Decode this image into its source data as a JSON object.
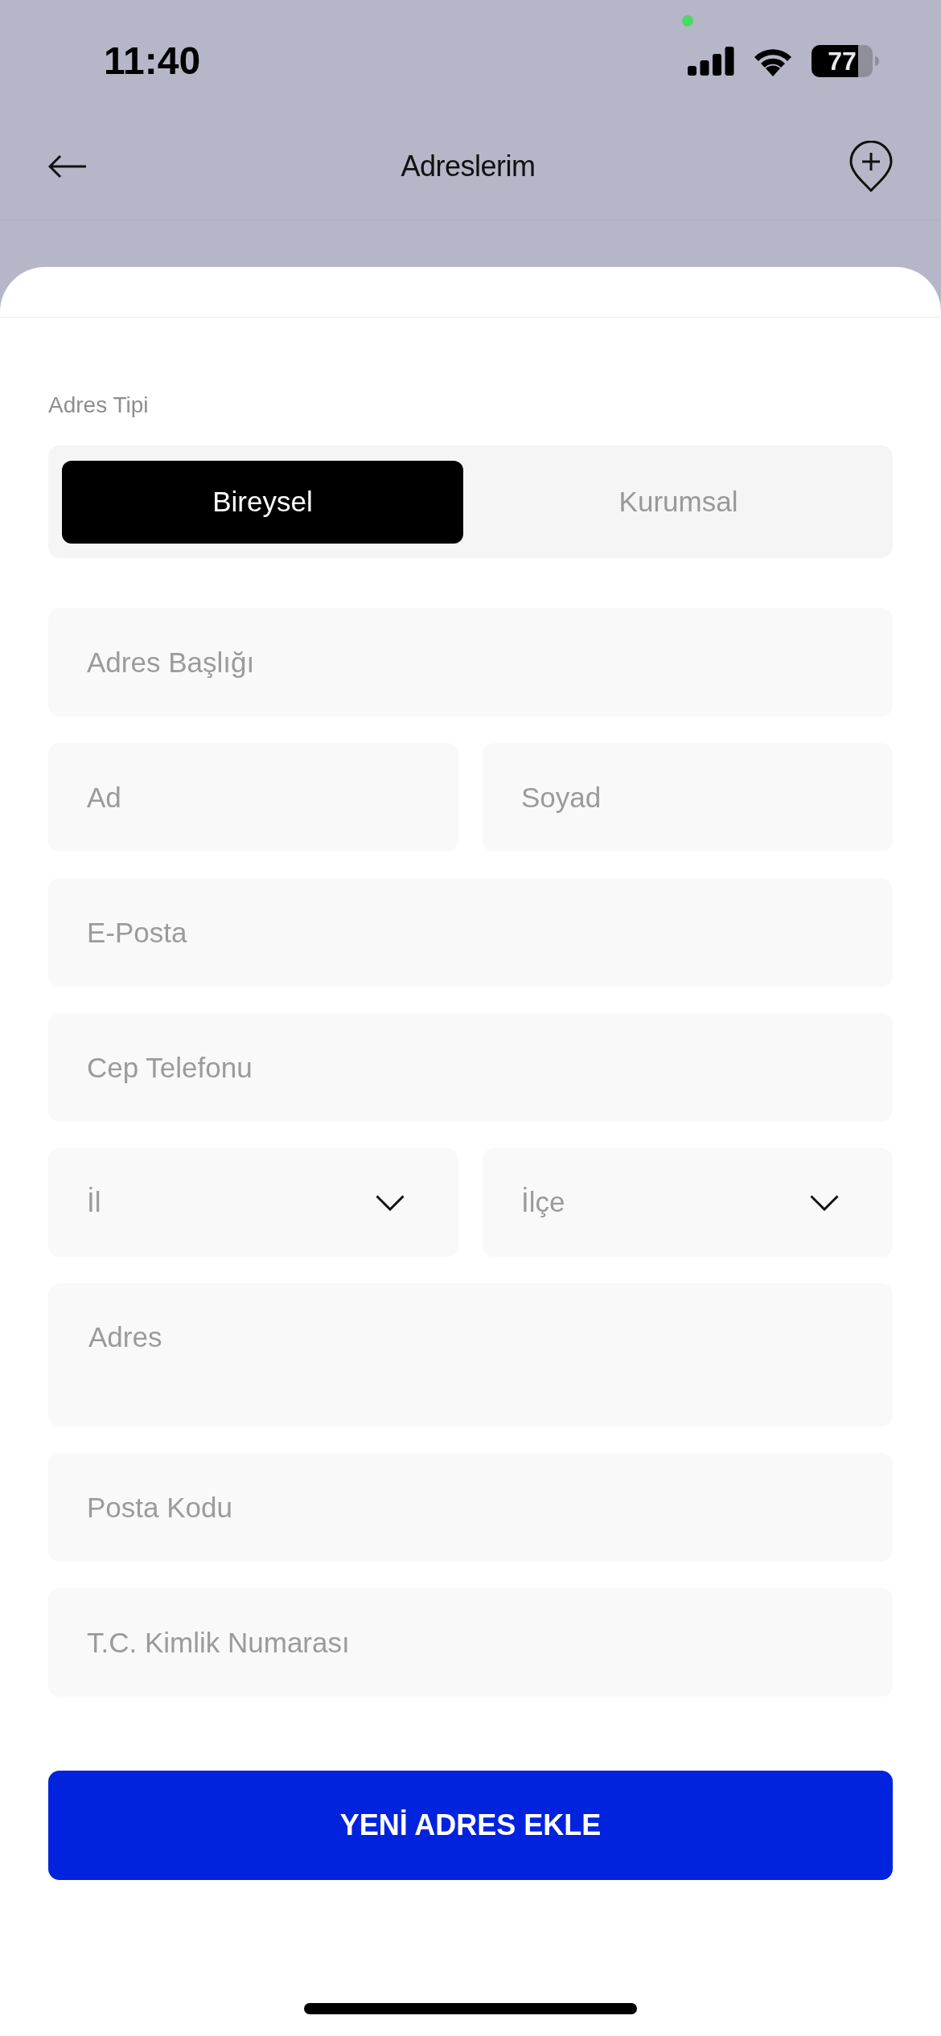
{
  "status_bar": {
    "time": "11:40",
    "battery": "77"
  },
  "header": {
    "title": "Adreslerim"
  },
  "form": {
    "address_type_label": "Adres Tipi",
    "address_type_options": [
      {
        "label": "Bireysel",
        "selected": true
      },
      {
        "label": "Kurumsal",
        "selected": false
      }
    ],
    "rows": [
      {
        "fields": [
          {
            "kind": "text",
            "placeholder": "Adres Başlığı"
          }
        ]
      },
      {
        "fields": [
          {
            "kind": "text",
            "placeholder": "Ad"
          },
          {
            "kind": "text",
            "placeholder": "Soyad"
          }
        ]
      },
      {
        "fields": [
          {
            "kind": "text",
            "placeholder": "E-Posta"
          }
        ]
      },
      {
        "fields": [
          {
            "kind": "text",
            "placeholder": "Cep Telefonu"
          }
        ]
      },
      {
        "fields": [
          {
            "kind": "select",
            "placeholder": "İl"
          },
          {
            "kind": "select",
            "placeholder": "İlçe"
          }
        ]
      },
      {
        "fields": [
          {
            "kind": "textarea",
            "placeholder": "Adres"
          }
        ]
      },
      {
        "fields": [
          {
            "kind": "text",
            "placeholder": "Posta Kodu"
          }
        ]
      },
      {
        "fields": [
          {
            "kind": "text",
            "placeholder": "T.C. Kimlik Numarası"
          }
        ]
      }
    ]
  },
  "submit_button": {
    "label": "YENİ ADRES EKLE"
  }
}
